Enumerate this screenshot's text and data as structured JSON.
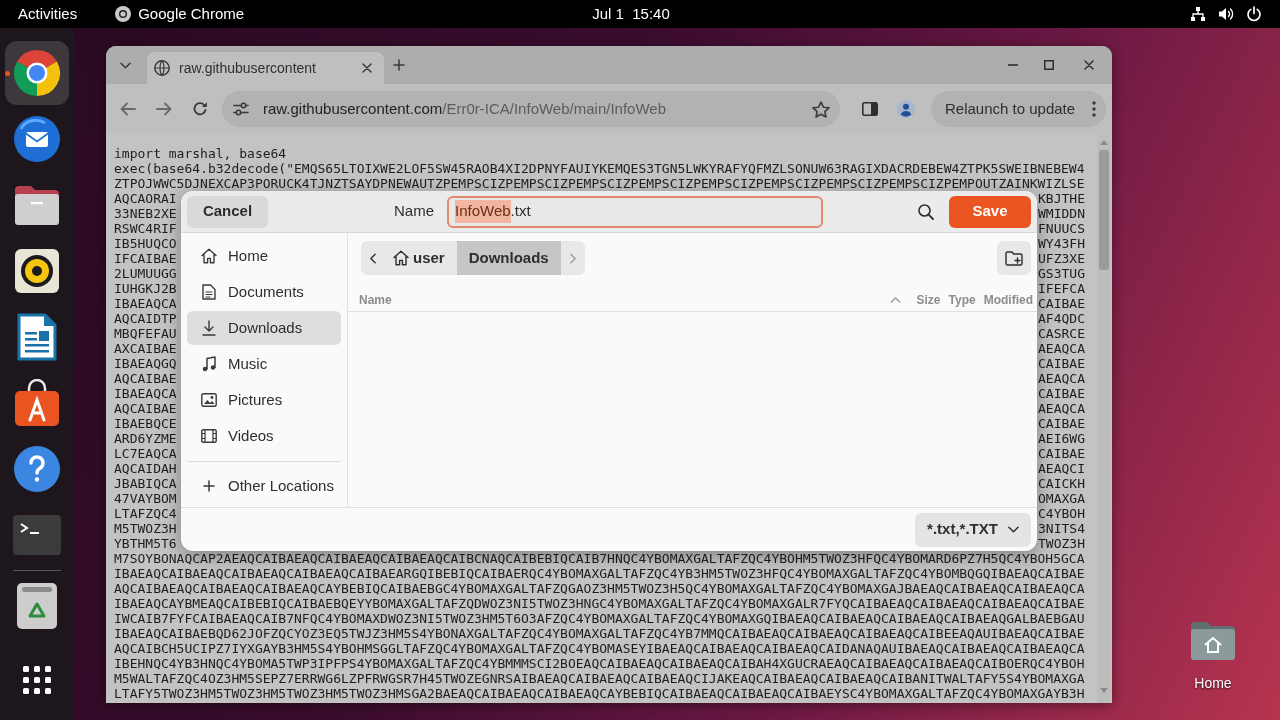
{
  "top_bar": {
    "activities": "Activities",
    "app_name": "Google Chrome",
    "clock": "Jul 1  15:40"
  },
  "dock": {
    "items": [
      {
        "kind": "browser",
        "running": true,
        "selected": true
      },
      {
        "kind": "mail",
        "running": false,
        "selected": false
      },
      {
        "kind": "files",
        "running": false,
        "selected": false
      },
      {
        "kind": "music",
        "running": false,
        "selected": false
      },
      {
        "kind": "writer",
        "running": false,
        "selected": false
      },
      {
        "kind": "store",
        "running": false,
        "selected": false
      },
      {
        "kind": "help",
        "running": false,
        "selected": false
      },
      {
        "kind": "terminal",
        "running": false,
        "selected": false
      },
      {
        "kind": "trash",
        "running": false,
        "selected": false
      }
    ]
  },
  "browser": {
    "tabs": [
      {
        "title": "raw.githubusercontent",
        "selected": true
      }
    ],
    "address": {
      "domain": "raw.githubusercontent.com",
      "path": "/Err0r-ICA/InfoWeb/main/InfoWeb"
    },
    "relaunch_button": "Relaunch to update",
    "page": {
      "lines": [
        {
          "kind": "full",
          "text": "import marshal, base64"
        },
        {
          "kind": "full",
          "text": "exec(base64.b32decode(\"EMQS65LTOIXWE2LOF5SW45RAOB4XI2DPNYFAUIYKEMQES3TGN5LWKYRAFYQFMZLSONUW63RAGIXDACRDEBEW4ZTPK5SWEIBNEBEW4"
        },
        {
          "kind": "full",
          "text": "ZTPOJWWC5DJNEXCAP3PORUCK4TJNZTSAYDPNEWAUTZPEMPSCIZPEMPSCIZPEMPSCIZPEMPSCIZPEMPSCIZPEMPSCIZPEMPSCIZPEMPSCIZPEMPOUTZAINKWIZLSE"
        },
        {
          "kind": "split",
          "left": "AQCAORAI",
          "right": "KBJTHE"
        },
        {
          "kind": "split",
          "left": "33NEB2XE",
          "right": "WMIDDN"
        },
        {
          "kind": "split",
          "left": "RSWC4RIF",
          "right": "FNUUCS"
        },
        {
          "kind": "split",
          "left": "IB5HUQCO",
          "right": "WY43FH"
        },
        {
          "kind": "split",
          "left": "IFCAIBAE",
          "right": "UFZ3XE"
        },
        {
          "kind": "split",
          "left": "2LUMUUGG",
          "right": "GS3TUG"
        },
        {
          "kind": "split",
          "left": "IUHGKJ2B",
          "right": "IFEFCA"
        },
        {
          "kind": "split",
          "left": "IBAEAQCA",
          "right": "CAIBAE"
        },
        {
          "kind": "split",
          "left": "AQCAIDTP",
          "right": "AF4QDC"
        },
        {
          "kind": "split",
          "left": "MBQFEFAU",
          "right": "CASRCE"
        },
        {
          "kind": "split",
          "left": "AXCAIBAE",
          "right": "AEAQCA"
        },
        {
          "kind": "split",
          "left": "IBAEAQGQ",
          "right": "CAIBAE"
        },
        {
          "kind": "split",
          "left": "AQCAIBAE",
          "right": "AEAQCA"
        },
        {
          "kind": "split",
          "left": "IBAEAQCA",
          "right": "CAIBAE"
        },
        {
          "kind": "split",
          "left": "AQCAIBAE",
          "right": "AEAQCA"
        },
        {
          "kind": "split",
          "left": "IBAEBQCE",
          "right": "CAIBAE"
        },
        {
          "kind": "split",
          "left": "ARD6YZME",
          "right": "AEI6WG"
        },
        {
          "kind": "split",
          "left": "LC7EAQCA",
          "right": "CAIBAE"
        },
        {
          "kind": "split",
          "left": "AQCAIDAH",
          "right": "AEAQCI"
        },
        {
          "kind": "split",
          "left": "JBABIQCA",
          "right": "CAICKH"
        },
        {
          "kind": "split",
          "left": "47VAYBOM",
          "right": "OMAXGA"
        },
        {
          "kind": "split",
          "left": "LTAFZQC4",
          "right": "C4YBOH"
        },
        {
          "kind": "split",
          "left": "M5TWOZ3H",
          "right": "3NITS4"
        },
        {
          "kind": "split",
          "left": "YBTHM5T6",
          "right": "TWOZ3H"
        },
        {
          "kind": "full",
          "text": "M7SOYBONAQCAP2AEAQCAIBAEAQCAIBAEAQCAIBAEAQCAIBCNAQCAIBEBIQCAIB7HNQC4YBOMAXGALTAFZQC4YBOHM5TWOZ3HFQC4YBOMARD6PZ7H5QC4YBOH5GCA"
        },
        {
          "kind": "full",
          "text": "IBAEAQCAIBAEAQCAIBAEAQCAIBAEAQCAIBAEARGQIBEBIQCAIBAERQC4YBOMAXGALTAFZQC4YB3HM5TWOZ3HFQC4YBOMAXGALTAFZQC4YBOMBQGQIBAEAQCAIBAE"
        },
        {
          "kind": "full",
          "text": "AQCAIBAEAQCAIBAEAQCAIBAEAQCAYBEBIQCAIBAEBGC4YBOMAXGALTAFZQGAOZ3HM5TWOZ3H5QC4YBOMAXGALTAFZQC4YBOMAXGAJBAEAQCAIBAEAQCAIBAEAQCA"
        },
        {
          "kind": "full",
          "text": "IBAEAQCAYBMEAQCAIBEBIQCAIBAEBQEYYBOMAXGALTAFZQDWOZ3NI5TWOZ3HNGC4YBOMAXGALTAFZQC4YBOMAXGALR7FYQCAIBAEAQCAIBAEAQCAIBAEAQCAIBAE"
        },
        {
          "kind": "full",
          "text": "IWCAIB7FYFCAIBAEAQCAIB7NFQC4YBOMAXDWOZ3NI5TWOZ3HM5T6O3AFZQC4YBOMAXGALTAFZQC4YBOMAXGQIBAEAQCAIBAEAQCAIBAEAQCAIBAEAQGALBAEBGAU"
        },
        {
          "kind": "full",
          "text": "IBAEAQCAIBAEBQD62JOFZQCYOZ3EQ5TWJZ3HM5S4YBONAXGALTAFZQC4YBOMAXGALTAFZQC4YB7MMQCAIBAEAQCAIBAEAQCAIBAEAQCAIBEEAQAUIBAEAQCAIBAE"
        },
        {
          "kind": "full",
          "text": "AQCAIBCH5UCIPZ7IYXGAYB3HM5S4YBOHMSGGLTAFZQC4YBOMAXGALTAFZQC4YBOMASEYIBAEAQCAIBAEAQCAIBAEAQCAIDANAQAUIBAEAQCAIBAEAQCAIBAEAQCA"
        },
        {
          "kind": "full",
          "text": "IBEHNQC4YB3HNQC4YBOMA5TWP3IPFPS4YBOMAXGALTAFZQC4YBMMMSCI2BOEAQCAIBAEAQCAIBAEAQCAIBAH4XGUCRAEAQCAIBAEAQCAIBAEAQCAIBOERQC4YBOH"
        },
        {
          "kind": "full",
          "text": "M5WALTAFZQC4OZ3HM5SEPZ7ERRWG6LZPFRWGSR7H45TWOZEGNRSAIBAEAQCAIBAEAQCAIBAEAQCIJAKEAQCAIBAEAQCAIBAEAQCAIBANITWALTAFY5S4YBOMAXGA"
        },
        {
          "kind": "full",
          "text": "LTAFY5TWOZ3HM5TWOZ3HM5TWOZ3HM5TWOZ3HMSGA2BAEAQCAIBAEAQCAIBAEAQCAYBEBIQCAIBAEAQCAIBAEAQCAIBAEYSC4YBOMAXGALTAFZQC4YBOMAXGAYB3H"
        }
      ]
    }
  },
  "save_dialog": {
    "cancel_button": "Cancel",
    "name_label": "Name",
    "name_field": [
      {
        "text": "InfoWeb",
        "selected": true
      },
      {
        "text": ".txt",
        "selected": false
      }
    ],
    "save_button": "Save",
    "places": [
      {
        "kind": "home",
        "label": "Home",
        "selected": false
      },
      {
        "kind": "documents",
        "label": "Documents",
        "selected": false
      },
      {
        "kind": "downloads",
        "label": "Downloads",
        "selected": true
      },
      {
        "kind": "music",
        "label": "Music",
        "selected": false
      },
      {
        "kind": "pictures",
        "label": "Pictures",
        "selected": false
      },
      {
        "kind": "videos",
        "label": "Videos",
        "selected": false
      }
    ],
    "other_locations": "Other Locations",
    "path_bar": [
      {
        "kind": "home",
        "label": "user",
        "selected": false
      },
      {
        "kind": "folder",
        "label": "Downloads",
        "selected": true
      }
    ],
    "columns": [
      {
        "label": "Name",
        "sorted": true
      },
      {
        "label": "Size",
        "sorted": false
      },
      {
        "label": "Type",
        "sorted": false
      },
      {
        "label": "Modified",
        "sorted": false
      }
    ],
    "file_type_filter": "*.txt,*.TXT"
  },
  "desktop_icons": [
    {
      "label": "Home"
    }
  ]
}
